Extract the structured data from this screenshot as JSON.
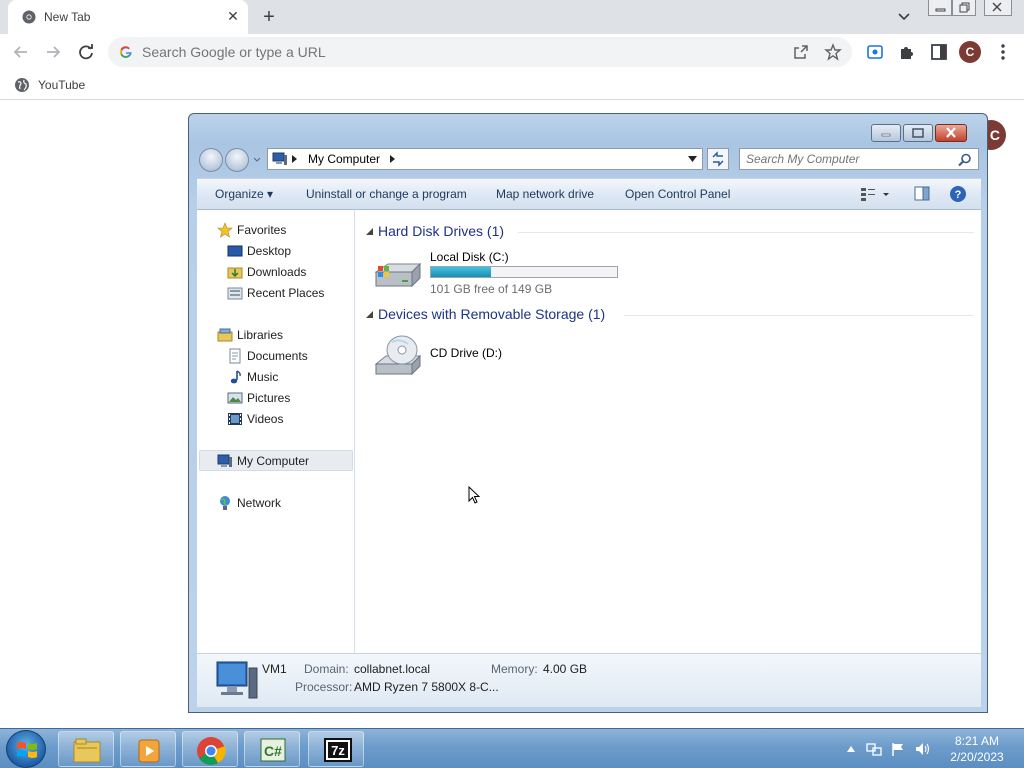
{
  "browser": {
    "tab": {
      "title": "New Tab"
    },
    "omnibox": {
      "placeholder": "Search Google or type a URL"
    },
    "avatar_letter": "C",
    "bookmarks": [
      {
        "label": "YouTube"
      }
    ]
  },
  "explorer": {
    "breadcrumb": "My Computer",
    "search_placeholder": "Search My Computer",
    "commands": {
      "organize": "Organize",
      "uninstall": "Uninstall or change a program",
      "map_drive": "Map network drive",
      "control_panel": "Open Control Panel"
    },
    "nav": {
      "favorites": "Favorites",
      "desktop": "Desktop",
      "downloads": "Downloads",
      "recent": "Recent Places",
      "libraries": "Libraries",
      "documents": "Documents",
      "music": "Music",
      "pictures": "Pictures",
      "videos": "Videos",
      "my_computer": "My Computer",
      "network": "Network"
    },
    "groups": {
      "hdd": "Hard Disk Drives (1)",
      "removable": "Devices with Removable Storage (1)"
    },
    "drives": {
      "c": {
        "name": "Local Disk (C:)",
        "free": "101 GB free of 149 GB",
        "used_fraction": 0.32
      },
      "d": {
        "name": "CD Drive (D:)"
      }
    },
    "details": {
      "name": "VM1",
      "domain_label": "Domain:",
      "domain": "collabnet.local",
      "memory_label": "Memory:",
      "memory": "4.00 GB",
      "processor_label": "Processor:",
      "processor": "AMD Ryzen 7 5800X 8-C..."
    }
  },
  "taskbar": {
    "time": "8:21 AM",
    "date": "2/20/2023"
  },
  "colors": {
    "chrome_tabstrip": "#dee1e6",
    "avatar": "#7b3a33",
    "explorer_frame": "#bcd3ea",
    "group_title": "#1e3287",
    "taskbar": "#6d9ccb"
  }
}
